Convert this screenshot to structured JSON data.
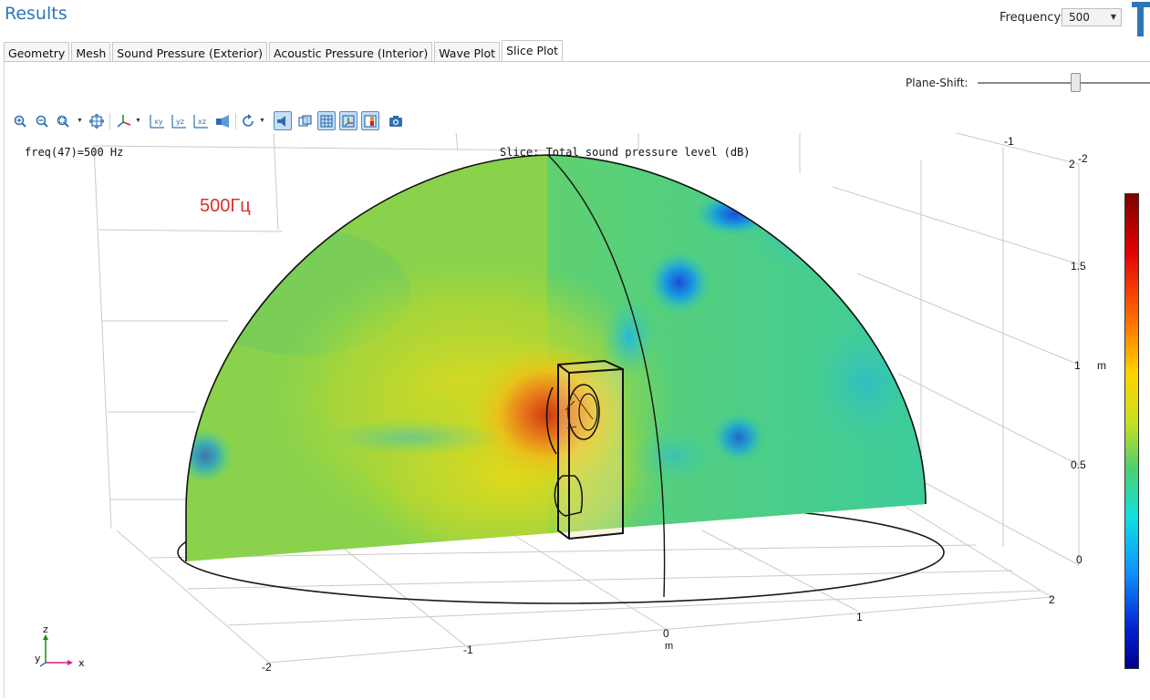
{
  "window": {
    "title": "Results"
  },
  "frequency": {
    "label": "Frequency:",
    "value": "500"
  },
  "tabs": [
    {
      "label": "Geometry",
      "active": false
    },
    {
      "label": "Mesh",
      "active": false
    },
    {
      "label": "Sound Pressure (Exterior)",
      "active": false
    },
    {
      "label": "Acoustic Pressure (Interior)",
      "active": false
    },
    {
      "label": "Wave Plot",
      "active": false
    },
    {
      "label": "Slice Plot",
      "active": true
    }
  ],
  "plane_shift": {
    "label": "Plane-Shift:",
    "level": 0.57
  },
  "toolbar_icons": [
    "zoom-in-icon",
    "zoom-out-icon",
    "zoom-box-icon",
    "zoom-extents-icon",
    "view-axis-icon",
    "view-xy-icon",
    "view-yz-icon",
    "view-xz-icon",
    "go-to-default-view-icon",
    "rotate-icon",
    "scene-light-icon",
    "transparency-icon",
    "show-grid-icon",
    "show-axis-orientation-icon",
    "show-legends-icon",
    "snapshot-icon"
  ],
  "plot": {
    "info_left": "freq(47)=500 Hz",
    "info_title": "Slice: Total sound pressure level (dB)",
    "annotation": "500Гц",
    "axis_unit": "m",
    "z_ticks": [
      "0",
      "0.5",
      "1",
      "1.5",
      "2"
    ],
    "x_ticks": [
      "-2",
      "-1",
      "0",
      "1",
      "2"
    ],
    "y_ticks": [
      "-1",
      "-2"
    ],
    "axis_triad": {
      "x": "x",
      "y": "y",
      "z": "z"
    }
  },
  "colors": {
    "title": "#2e75b6",
    "field_base": "#7fd24a",
    "hot_spot": "#d03a10",
    "cold_spot": "#1a6fe0"
  }
}
